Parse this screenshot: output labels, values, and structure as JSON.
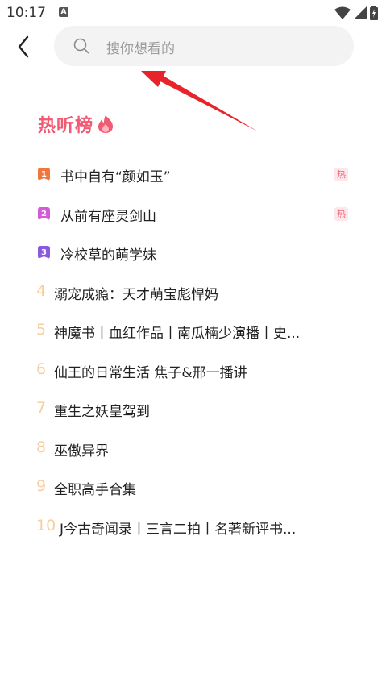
{
  "status": {
    "time": "10:17",
    "indicator": "A"
  },
  "search": {
    "placeholder": "搜你想看的"
  },
  "section": {
    "title": "热听榜"
  },
  "colors": {
    "accent": "#f05a73",
    "rank_muted": "#f5cf9f",
    "rank1": "#f0763b",
    "rank2": "#d35bd9",
    "rank3": "#8b59e0"
  },
  "items": [
    {
      "rank": "1",
      "title": "书中自有“颜如玉”",
      "tag": "热"
    },
    {
      "rank": "2",
      "title": "从前有座灵剑山",
      "tag": "热"
    },
    {
      "rank": "3",
      "title": "冷校草的萌学妹",
      "tag": ""
    },
    {
      "rank": "4",
      "title": "溺宠成瘾：天才萌宝彪悍妈",
      "tag": ""
    },
    {
      "rank": "5",
      "title": "神魔书丨血红作品丨南瓜楠少演播丨史...",
      "tag": ""
    },
    {
      "rank": "6",
      "title": "仙王的日常生活 焦子&邢一播讲",
      "tag": ""
    },
    {
      "rank": "7",
      "title": "重生之妖皇驾到",
      "tag": ""
    },
    {
      "rank": "8",
      "title": "巫傲异界",
      "tag": ""
    },
    {
      "rank": "9",
      "title": "全职高手合集",
      "tag": ""
    },
    {
      "rank": "10",
      "title": "J今古奇闻录丨三言二拍丨名著新评书...",
      "tag": ""
    }
  ]
}
